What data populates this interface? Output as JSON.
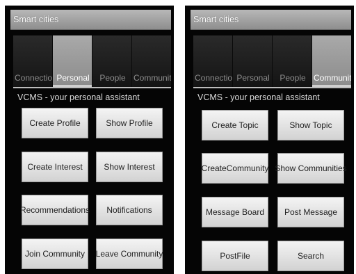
{
  "left_screen": {
    "title": "Smart cities",
    "tabs": [
      {
        "label": "Connection",
        "active": false
      },
      {
        "label": "Personal",
        "active": true
      },
      {
        "label": "People",
        "active": false
      },
      {
        "label": "Communitie",
        "active": false
      }
    ],
    "subtitle": "VCMS - your personal assistant",
    "buttons": [
      "Create Profile",
      "Show Profile",
      "Create Interest",
      "Show Interest",
      "Recommendations",
      "Notifications",
      "Join Community",
      "Leave Community"
    ]
  },
  "right_screen": {
    "title": "Smart cities",
    "tabs": [
      {
        "label": "Connection",
        "active": false
      },
      {
        "label": "Personal",
        "active": false
      },
      {
        "label": "People",
        "active": false
      },
      {
        "label": "Communitie",
        "active": true
      }
    ],
    "subtitle": "VCMS - your personal assistant",
    "buttons": [
      "Create Topic",
      "Show Topic",
      "CreateCommunity",
      "Show Communities",
      "Message Board",
      "Post Message",
      "PostFile",
      "Search"
    ]
  },
  "colors": {
    "screen_background": "#050505",
    "titlebar": "#a3a3a3",
    "active_tab": "#999999",
    "button": "#e4e4e4"
  }
}
